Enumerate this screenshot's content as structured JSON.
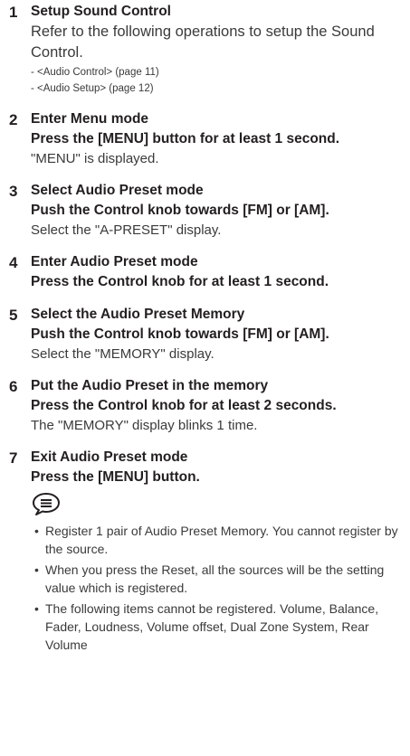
{
  "steps": [
    {
      "num": "1",
      "title": "Setup Sound Control",
      "instruction": "",
      "description": "Refer to the following operations to setup the Sound Control.",
      "links": [
        "- <Audio Control> (page 11)",
        "- <Audio Setup> (page 12)"
      ]
    },
    {
      "num": "2",
      "title": "Enter Menu mode",
      "instruction": "Press the [MENU] button for at least 1 second.",
      "description": "\"MENU\" is displayed."
    },
    {
      "num": "3",
      "title": "Select Audio Preset mode",
      "instruction": "Push the Control knob towards [FM] or [AM].",
      "description": "Select the \"A-PRESET\" display."
    },
    {
      "num": "4",
      "title": "Enter Audio Preset mode",
      "instruction": "Press the Control knob for at least 1 second.",
      "description": ""
    },
    {
      "num": "5",
      "title": "Select the Audio Preset Memory",
      "instruction": "Push the Control knob towards [FM] or [AM].",
      "description": "Select the \"MEMORY\" display."
    },
    {
      "num": "6",
      "title": "Put the Audio Preset in the memory",
      "instruction": "Press the Control knob for at least 2 seconds.",
      "description": "The \"MEMORY\" display blinks 1 time."
    },
    {
      "num": "7",
      "title": "Exit Audio Preset mode",
      "instruction": "Press the [MENU] button.",
      "description": ""
    }
  ],
  "note_icon": "note-icon",
  "notes": [
    "Register 1 pair of Audio Preset Memory. You cannot register by the source.",
    "When you press the Reset, all the sources will be the setting value which is registered.",
    "The following items cannot be registered. Volume, Balance, Fader, Loudness, Volume offset, Dual Zone System, Rear Volume"
  ],
  "bullet_char": "•"
}
